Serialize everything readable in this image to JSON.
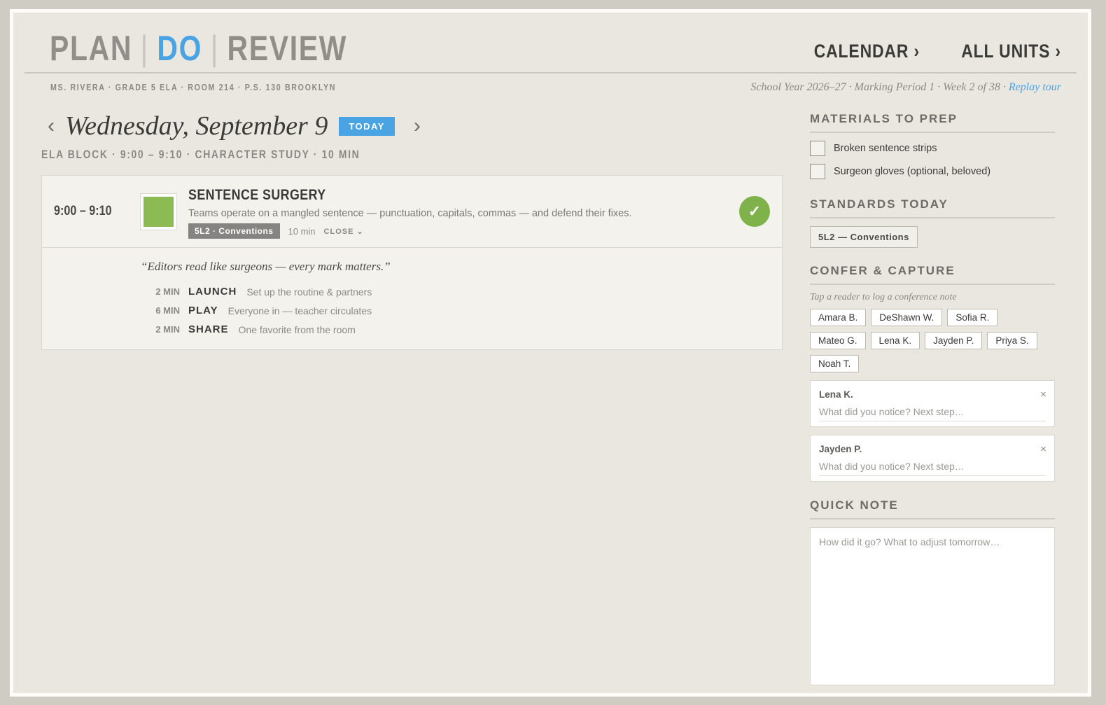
{
  "brand": {
    "plan": "PLAN",
    "do": "DO",
    "review": "REVIEW",
    "sep": "|"
  },
  "nav": {
    "calendar": "CALENDAR ›",
    "all_units": "ALL UNITS ›"
  },
  "meta": {
    "teacher": "MS. RIVERA · GRADE 5 ELA · ROOM 214 · P.S. 130 BROOKLYN",
    "year": "School Year 2026–27 · Marking Period 1 · Week 2 of 38 · ",
    "replay": "Replay tour"
  },
  "day": {
    "prev": "‹",
    "next": "›",
    "title": "Wednesday, September 9",
    "today": "TODAY",
    "block": "ELA BLOCK · 9:00 – 9:10 · CHARACTER STUDY · 10 MIN"
  },
  "lesson": {
    "time": "9:00 – 9:10",
    "color": "#8cbb53",
    "title": "SENTENCE SURGERY",
    "desc": "Teams operate on a mangled sentence — punctuation, capitals, commas — and defend their fixes.",
    "standard": "5L2 · Conventions",
    "minutes": "10 min",
    "close": "CLOSE ⌄",
    "done": "✓",
    "quote": "“Editors read like surgeons — every mark matters.”",
    "steps": [
      {
        "dur": "2 MIN",
        "label": "LAUNCH",
        "text": "Set up the routine & partners"
      },
      {
        "dur": "6 MIN",
        "label": "PLAY",
        "text": "Everyone in — teacher circulates"
      },
      {
        "dur": "2 MIN",
        "label": "SHARE",
        "text": "One favorite from the room"
      }
    ]
  },
  "sidebar": {
    "materials_title": "MATERIALS TO PREP",
    "materials": [
      "Broken sentence strips",
      "Surgeon gloves (optional, beloved)"
    ],
    "standards_title": "STANDARDS TODAY",
    "standard_chip": "5L2 — Conventions",
    "confer_title": "CONFER & CAPTURE",
    "confer_hint": "Tap a reader to log a conference note",
    "students": [
      "Amara B.",
      "DeShawn W.",
      "Sofia R.",
      "Mateo G.",
      "Lena K.",
      "Jayden P.",
      "Priya S.",
      "Noah T."
    ],
    "notes": [
      {
        "name": "Lena K.",
        "placeholder": "What did you notice? Next step…",
        "close": "×"
      },
      {
        "name": "Jayden P.",
        "placeholder": "What did you notice? Next step…",
        "close": "×"
      }
    ],
    "quick_title": "QUICK NOTE",
    "quick_placeholder": "How did it go? What to adjust tomorrow…"
  },
  "colors": {
    "accent": "#4aa3e2",
    "done": "#7fb24a",
    "bg": "#eae7e0"
  }
}
